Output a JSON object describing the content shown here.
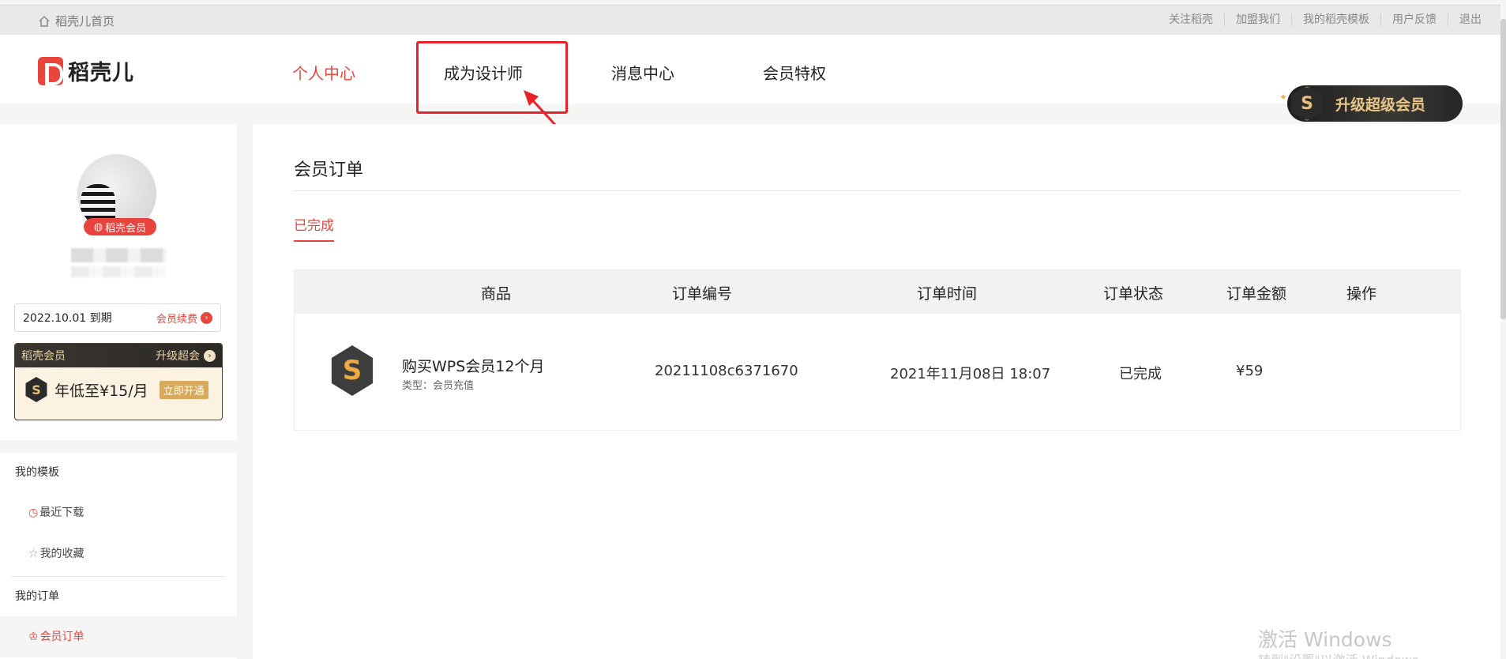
{
  "topbar": {
    "home_label": "稻壳儿首页",
    "links": [
      "关注稻壳",
      "加盟我们",
      "我的稻壳模板",
      "用户反馈",
      "退出"
    ]
  },
  "header": {
    "logo_text": "稻壳儿",
    "nav": [
      {
        "label": "个人中心",
        "active": true
      },
      {
        "label": "成为设计师",
        "active": false
      },
      {
        "label": "消息中心",
        "active": false
      },
      {
        "label": "会员特权",
        "active": false
      }
    ],
    "upgrade_label": "升级超级会员",
    "upgrade_icon": "S"
  },
  "profile": {
    "vip_badge": "稻壳会员",
    "expire_text": "2022.10.01 到期",
    "renew_label": "会员续费",
    "vip_card_title": "稻壳会员",
    "vip_card_upgrade": "升级超会",
    "vip_card_icon": "S",
    "vip_card_price": "年低至¥15/月",
    "vip_card_open": "立即开通"
  },
  "menu": {
    "templates_group": "我的模板",
    "recent_downloads": "最近下载",
    "favorites": "我的收藏",
    "orders_group": "我的订单",
    "member_orders": "会员订单"
  },
  "main": {
    "title": "会员订单",
    "subtab": "已完成",
    "columns": [
      "商品",
      "订单编号",
      "订单时间",
      "订单状态",
      "订单金额",
      "操作"
    ],
    "rows": [
      {
        "icon": "S",
        "product": "购买WPS会员12个月",
        "type": "类型：会员充值",
        "order_no": "20211108c6371670",
        "time": "2021年11月08日 18:07",
        "status": "已完成",
        "amount": "¥59",
        "action": ""
      }
    ]
  },
  "watermark": {
    "line1": "激活 Windows",
    "line2": "转到\"设置\"以激活 Windows。"
  },
  "colors": {
    "accent": "#e8453c",
    "annotation": "#e8232a",
    "gold": "#e9c787"
  }
}
